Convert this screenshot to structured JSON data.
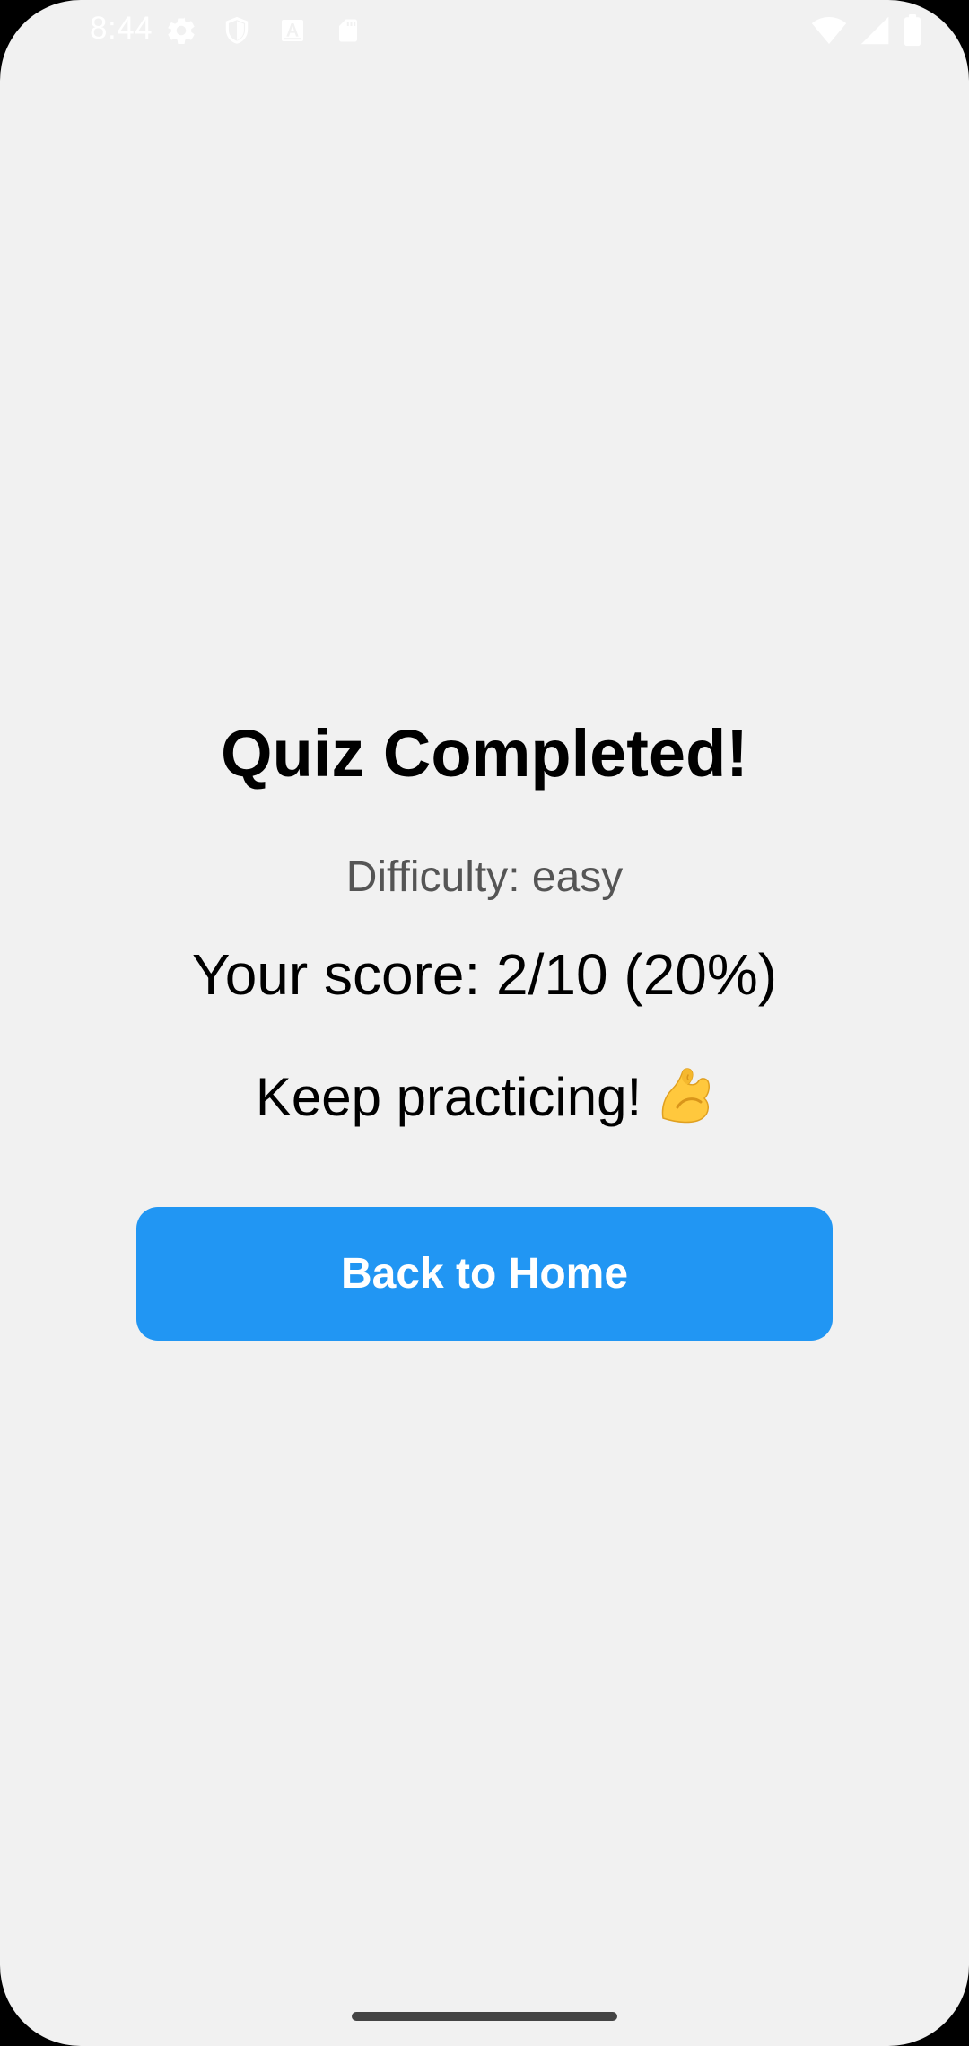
{
  "status_bar": {
    "time": "8:44",
    "icons_left": [
      "settings-icon",
      "shield-icon",
      "font-a-icon",
      "sd-card-icon"
    ],
    "icons_right": [
      "wifi-icon",
      "signal-icon",
      "battery-icon"
    ]
  },
  "main": {
    "title": "Quiz Completed!",
    "difficulty": "Difficulty: easy",
    "score": "Your score: 2/10 (20%)",
    "message": "Keep practicing!",
    "message_emoji": "flexed-biceps-emoji",
    "back_button_label": "Back to Home"
  },
  "colors": {
    "background": "#f1f1f1",
    "button": "#2196f3",
    "button_text": "#ffffff",
    "title_text": "#000000",
    "difficulty_text": "#555555"
  }
}
